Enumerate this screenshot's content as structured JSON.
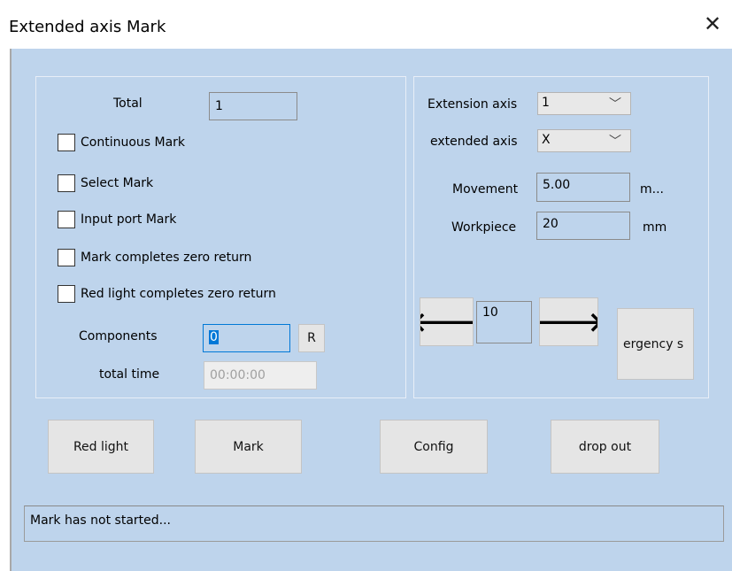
{
  "window": {
    "title": "Extended axis Mark",
    "close": "✕"
  },
  "left_panel": {
    "total_label": "Total",
    "total_value": "1",
    "checkboxes": [
      "Continuous Mark",
      "Select Mark",
      "Input port Mark",
      "Mark completes zero return",
      "Red light completes zero return"
    ],
    "components_label": "Components",
    "components_value": "0",
    "reset_button": "R",
    "total_time_label": "total time",
    "total_time_value": "00:00:00"
  },
  "right_panel": {
    "extension_axis_label": "Extension axis",
    "extension_axis_value": "1",
    "extended_axis_label": "extended axis",
    "extended_axis_value": "X",
    "movement_label": "Movement",
    "movement_value": "5.00",
    "movement_unit": "m...",
    "workpiece_label": "Workpiece",
    "workpiece_value": "20",
    "workpiece_unit": "mm",
    "step_value": "10",
    "left_arrow": "🡐",
    "right_arrow": "🡒",
    "emergency_button": "ergency s"
  },
  "actions": {
    "red_light": "Red light",
    "mark": "Mark",
    "config": "Config",
    "drop_out": "drop out"
  },
  "status": {
    "text": "Mark has not started..."
  },
  "colors": {
    "background": "#bed4ec",
    "button": "#e5e5e5",
    "selection": "#0078d7"
  }
}
